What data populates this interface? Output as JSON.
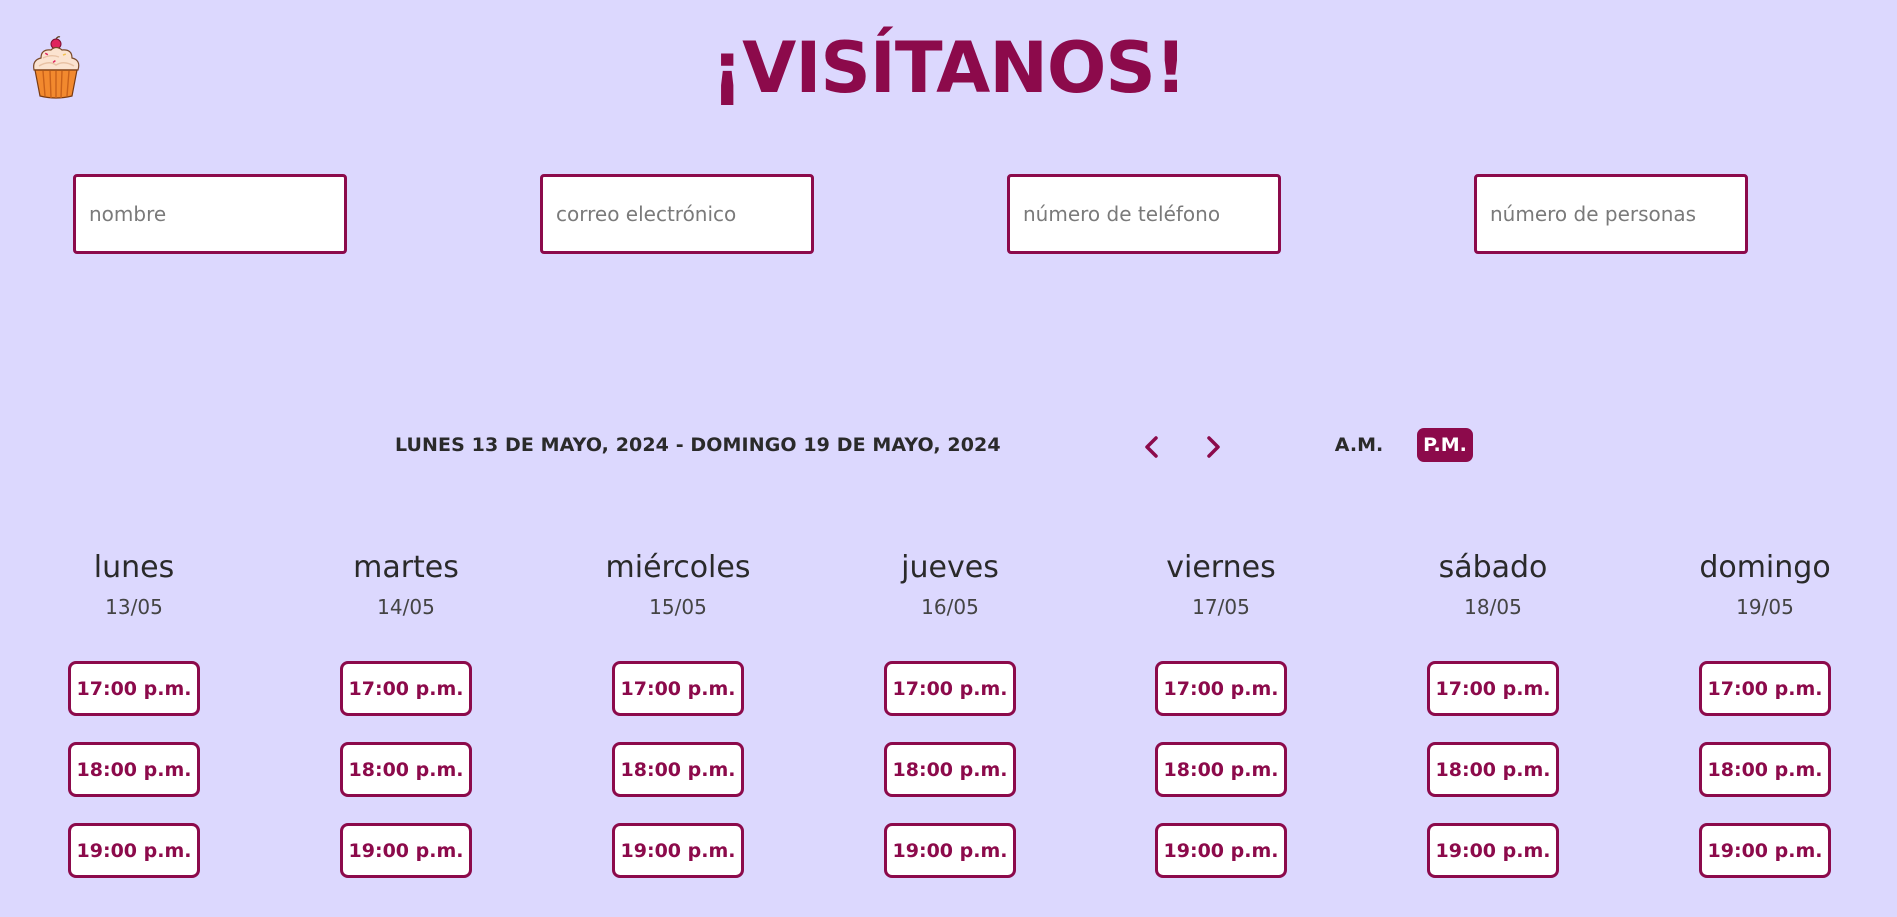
{
  "header": {
    "title": "¡VISÍTANOS!",
    "logo_icon": "cupcake-icon"
  },
  "form": {
    "name_placeholder": "nombre",
    "email_placeholder": "correo electrónico",
    "phone_placeholder": "número de teléfono",
    "people_placeholder": "número de personas"
  },
  "calendar": {
    "week_range": "LUNES 13 DE MAYO, 2024 - DOMINGO 19 DE MAYO, 2024",
    "prev_icon": "chevron-left-icon",
    "next_icon": "chevron-right-icon",
    "am_label": "A.M.",
    "pm_label": "P.M.",
    "selected_period": "P.M.",
    "days": [
      {
        "name": "lunes",
        "date": "13/05",
        "slots": [
          "17:00 p.m.",
          "18:00 p.m.",
          "19:00 p.m."
        ]
      },
      {
        "name": "martes",
        "date": "14/05",
        "slots": [
          "17:00 p.m.",
          "18:00 p.m.",
          "19:00 p.m."
        ]
      },
      {
        "name": "miércoles",
        "date": "15/05",
        "slots": [
          "17:00 p.m.",
          "18:00 p.m.",
          "19:00 p.m."
        ]
      },
      {
        "name": "jueves",
        "date": "16/05",
        "slots": [
          "17:00 p.m.",
          "18:00 p.m.",
          "19:00 p.m."
        ]
      },
      {
        "name": "viernes",
        "date": "17/05",
        "slots": [
          "17:00 p.m.",
          "18:00 p.m.",
          "19:00 p.m."
        ]
      },
      {
        "name": "sábado",
        "date": "18/05",
        "slots": [
          "17:00 p.m.",
          "18:00 p.m.",
          "19:00 p.m."
        ]
      },
      {
        "name": "domingo",
        "date": "19/05",
        "slots": [
          "17:00 p.m.",
          "18:00 p.m.",
          "19:00 p.m."
        ]
      }
    ]
  },
  "colors": {
    "background": "#dcd8fe",
    "accent": "#8c0a4b",
    "text": "#2a2a2a"
  }
}
